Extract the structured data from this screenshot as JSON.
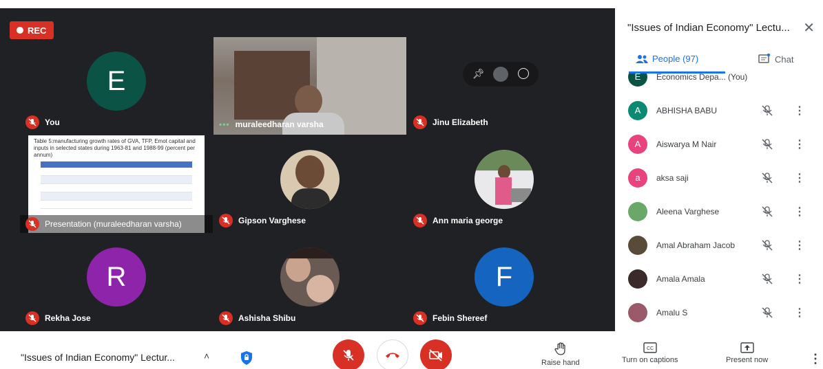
{
  "recording": {
    "label": "REC"
  },
  "tiles": {
    "you": {
      "initial": "E",
      "name": "You",
      "color": "#0b5345"
    },
    "speaker": {
      "name": "muraleedharan varsha",
      "dots": "•••"
    },
    "jinu": {
      "name": "Jinu Elizabeth"
    },
    "presentation": {
      "label": "Presentation (muraleedharan varsha)",
      "slide_text": "Table 5:manufacturing growth rates of GVA, TFP, Emot capital and inputs in selected states during 1963-81 and 1988-99 (percent per annum)"
    },
    "gipson": {
      "name": "Gipson Varghese"
    },
    "ann": {
      "name": "Ann maria george"
    },
    "rekha": {
      "initial": "R",
      "name": "Rekha Jose",
      "color": "#8e24aa"
    },
    "ashisha": {
      "name": "Ashisha Shibu"
    },
    "febin": {
      "initial": "F",
      "name": "Febin Shereef",
      "color": "#1565c0"
    }
  },
  "panel": {
    "title": "\"Issues of Indian Economy\" Lectu...",
    "tab_people": "People (97)",
    "tab_chat": "Chat",
    "partial_top": "Economics Depa...  (You)",
    "people": [
      {
        "initial": "A",
        "name": "ABHISHA BABU",
        "color": "#0a8a72"
      },
      {
        "initial": "A",
        "name": "Aiswarya M Nair",
        "color": "#e8437c"
      },
      {
        "initial": "a",
        "name": "aksa saji",
        "color": "#e8437c"
      },
      {
        "initial": "",
        "name": "Aleena Varghese",
        "color": "#6aa86a"
      },
      {
        "initial": "",
        "name": "Amal Abraham Jacob",
        "color": "#5a4a3a"
      },
      {
        "initial": "",
        "name": "Amala Amala",
        "color": "#3a2a2a"
      },
      {
        "initial": "",
        "name": "Amalu S",
        "color": "#9a5a6a"
      }
    ]
  },
  "bottom": {
    "meeting_title": "\"Issues of Indian Economy\" Lectur...",
    "raise_hand": "Raise hand",
    "captions": "Turn on captions",
    "present_now": "Present now"
  }
}
